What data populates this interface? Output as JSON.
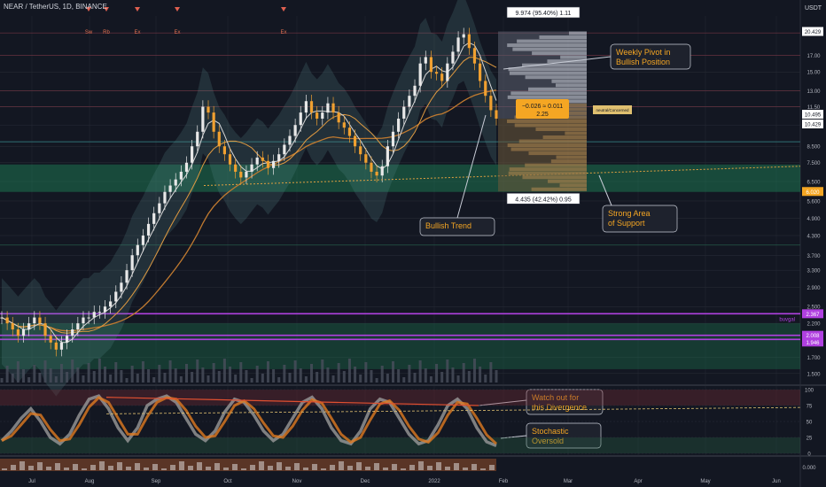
{
  "header": {
    "title": "NEAR / TetherUS, 1D, BINANCE",
    "currency": "USDT"
  },
  "colors": {
    "bg": "#131722",
    "up": "#e8e8e8",
    "down": "#f0a030",
    "grid": "#2a2e39",
    "zone": "#1f8a5a",
    "purple": "#b040e0",
    "annotation_bg": "#1e222d",
    "annotation_text": "#f5a623",
    "price_tag": "#e8e8e8",
    "orange_tag": "#f5a623"
  },
  "chart_data": [
    {
      "type": "line",
      "panel": "price",
      "scale": "log",
      "ylim": [
        1.4,
        23
      ],
      "y_ticks": [
        1.5,
        1.7,
        1.95,
        2.2,
        2.5,
        2.9,
        3.3,
        3.7,
        4.3,
        4.9,
        5.6,
        6.5,
        7.5,
        8.5,
        10,
        11.5,
        13,
        15,
        17
      ],
      "x_ticks": [
        "Jul",
        "Aug",
        "Sep",
        "Oct",
        "Nov",
        "Dec",
        "2022",
        "Feb",
        "Mar",
        "Apr",
        "May",
        "Jun"
      ],
      "price_axis_tags": [
        "20.429",
        "10.495",
        "10.429",
        "6.020",
        "2.367",
        "2.008",
        "1.946"
      ],
      "series": [
        {
          "name": "",
          "color": "#e8e8e8",
          "values": [
            2.3,
            2.2,
            2.1,
            2.0,
            2.1,
            2.2,
            2.3,
            2.2,
            2.0,
            1.9,
            1.8,
            1.9,
            2.0,
            2.1,
            2.2,
            2.3,
            2.3,
            2.4,
            2.4,
            2.5,
            2.6,
            2.8,
            3.0,
            3.3,
            3.7,
            4.0,
            4.3,
            4.7,
            5.1,
            5.5,
            6.0,
            6.3,
            6.6,
            7.0,
            7.5,
            8.5,
            9.5,
            11.5,
            11.0,
            9.5,
            8.5,
            8.0,
            7.4,
            7.0,
            6.7,
            7.0,
            7.4,
            7.8,
            7.6,
            7.2,
            7.6,
            8.0,
            8.6,
            9.2,
            10.0,
            11.0,
            12.0,
            11.0,
            10.5,
            11.0,
            11.8,
            11.0,
            10.2,
            9.8,
            9.2,
            8.5,
            8.0,
            7.5,
            7.0,
            6.8,
            7.3,
            8.5,
            9.5,
            10.5,
            11.5,
            12.5,
            13.5,
            16.0,
            16.8,
            15.0,
            14.8,
            14.0,
            16.0,
            17.5,
            19.5,
            20.0,
            18.0,
            16.0,
            14.0,
            12.5,
            11.2,
            10.5
          ]
        }
      ],
      "zones": [
        {
          "name": "Strong Area of Support",
          "range": [
            6.0,
            7.4
          ]
        },
        {
          "name": "",
          "range": [
            1.55,
            2.2
          ]
        }
      ],
      "levels": [
        {
          "value": 2.367,
          "label": "buvgal",
          "color": "#b040e0"
        },
        {
          "value": 2.008,
          "label": "",
          "color": "#b040e0"
        },
        {
          "value": 1.946,
          "label": "",
          "color": "#b040e0"
        }
      ],
      "measure_box": {
        "top_label": "9.974 (95.40%) 1.11",
        "bottom_label": "4.435 (42.42%) 0.95",
        "range": [
          6.02,
          20.43
        ]
      },
      "tooltip": {
        "line1": "−0.026 ≈ 0.011",
        "line2": "2.25"
      },
      "marker_labels": [
        "Sw",
        "Rb",
        "Ex",
        "Ex",
        "Ex"
      ],
      "side_tag": "neutral/Concerned"
    },
    {
      "type": "line",
      "panel": "stochastic",
      "ylim": [
        0,
        100
      ],
      "y_ticks": [
        100,
        75,
        50,
        25,
        0
      ],
      "series": [
        {
          "name": "",
          "color": "#9a9a9a",
          "values": [
            20,
            35,
            55,
            70,
            50,
            25,
            15,
            30,
            60,
            85,
            90,
            70,
            40,
            20,
            40,
            75,
            85,
            90,
            80,
            55,
            30,
            20,
            35,
            65,
            85,
            80,
            60,
            35,
            20,
            30,
            55,
            80,
            88,
            70,
            40,
            20,
            15,
            35,
            70,
            85,
            80,
            55,
            30,
            15,
            20,
            45,
            75,
            85,
            70,
            40,
            18,
            12
          ]
        }
      ]
    }
  ],
  "annotations": {
    "weekly_pivot": "Weekly Pivot in Bullish Position",
    "bullish_trend": "Bullish Trend",
    "support": "Strong Area of Support",
    "divergence": "Watch out for this Divergence",
    "stochastic": "Stochastic Oversold"
  }
}
